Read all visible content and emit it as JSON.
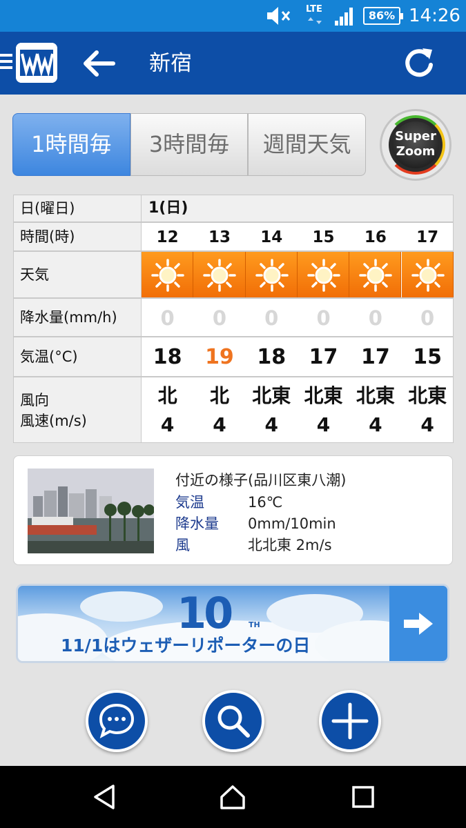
{
  "status_bar": {
    "network": "LTE",
    "battery": "86%",
    "time": "14:26",
    "icons": [
      "mute-icon",
      "signal-icon",
      "battery-icon"
    ]
  },
  "app_bar": {
    "title": "新宿",
    "icons": [
      "menu-icon",
      "weathernews-logo",
      "back-arrow-icon",
      "refresh-icon"
    ]
  },
  "tabs": [
    {
      "label": "1時間毎",
      "active": true
    },
    {
      "label": "3時間毎",
      "active": false
    },
    {
      "label": "週間天気",
      "active": false
    }
  ],
  "super_zoom": {
    "line1": "Super",
    "line2": "Zoom"
  },
  "forecast_table": {
    "row_labels": {
      "date": "日(曜日)",
      "time": "時間(時)",
      "weather": "天気",
      "precip": "降水量(mm/h)",
      "temp": "気温(°C)",
      "wind_dir": "風向",
      "wind_speed": "風速(m/s)"
    },
    "date": "1(日)",
    "hours": [
      "12",
      "13",
      "14",
      "15",
      "16",
      "17"
    ],
    "weather": [
      "sunny-icon",
      "sunny-icon",
      "sunny-icon",
      "sunny-icon",
      "sunny-icon",
      "sunny-icon"
    ],
    "precip": [
      "0",
      "0",
      "0",
      "0",
      "0",
      "0"
    ],
    "temps": [
      "18",
      "19",
      "18",
      "17",
      "17",
      "15"
    ],
    "highlight_temp_index": 1,
    "wind_dir": [
      "北",
      "北",
      "北東",
      "北東",
      "北東",
      "北東"
    ],
    "wind_speed": [
      "4",
      "4",
      "4",
      "4",
      "4",
      "4"
    ],
    "colors": {
      "sunny_bg": "#f57c0c",
      "highlight_temp": "#ef7420",
      "precip_zero": "#d7d7d7"
    }
  },
  "nearby": {
    "heading": "付近の様子(品川区東八潮)",
    "temp_label": "気温",
    "temp_value": "16℃",
    "precip_label": "降水量",
    "precip_value": "0mm/10min",
    "wind_label": "風",
    "wind_value": "北北東 2m/s"
  },
  "banner": {
    "big_number": "10",
    "suffix": "TH",
    "text": "11/1はウェザーリポーターの日",
    "icon": "arrow-right-icon"
  },
  "fab_buttons": [
    "chat-icon",
    "search-icon",
    "add-icon"
  ],
  "nav_bar": [
    "back-icon",
    "home-icon",
    "recents-icon"
  ],
  "colors": {
    "app_bar": "#0d4ea7",
    "status_bar": "#1583d6",
    "active_tab": "#4a8fe3"
  }
}
